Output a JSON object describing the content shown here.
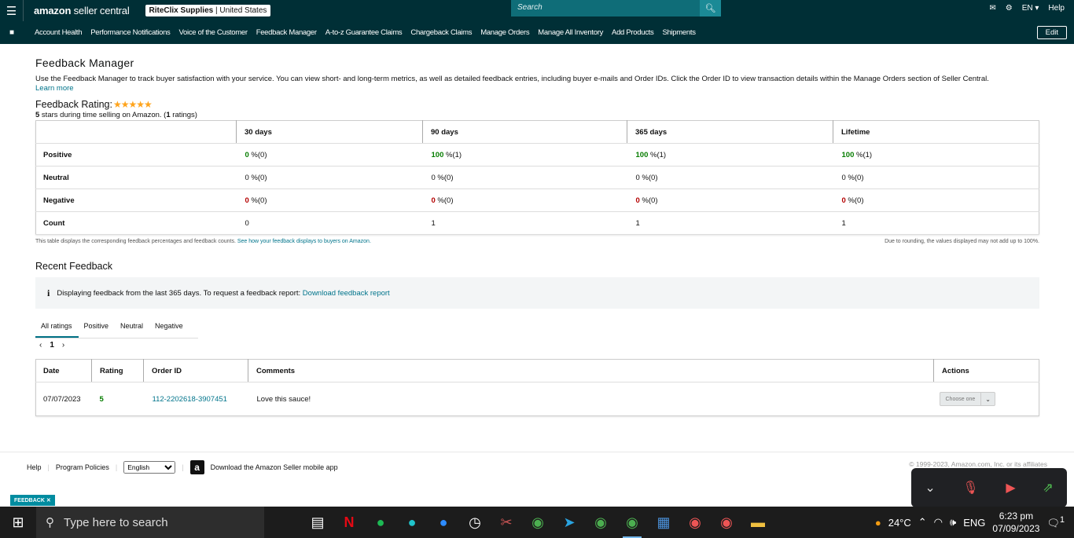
{
  "topbar": {
    "menu_icon": "hamburger-icon",
    "logo_bold": "amazon",
    "logo_rest": " seller central",
    "store_name": "RiteClix Supplies",
    "store_region": "United States",
    "search_placeholder": "Search",
    "language": "EN",
    "help": "Help"
  },
  "nav": {
    "items": [
      "Account Health",
      "Performance Notifications",
      "Voice of the Customer",
      "Feedback Manager",
      "A-to-z Guarantee Claims",
      "Chargeback Claims",
      "Manage Orders",
      "Manage All Inventory",
      "Add Products",
      "Shipments"
    ],
    "edit": "Edit"
  },
  "page": {
    "title": "Feedback Manager",
    "description": "Use the Feedback Manager to track buyer satisfaction with your service. You can view short- and long-term metrics, as well as detailed feedback entries, including buyer e-mails and Order IDs. Click the Order ID to view transaction details within the Manage Orders section of Seller Central.",
    "learn_more": "Learn more",
    "rating_label": "Feedback Rating:",
    "stars": "★★★★★",
    "rating_stars_pre": "5",
    "rating_sub_mid": " stars during time selling on Amazon. (",
    "rating_count": "1",
    "rating_sub_post": " ratings)"
  },
  "summary": {
    "headers": [
      "",
      "30 days",
      "90 days",
      "365 days",
      "Lifetime"
    ],
    "rows": [
      {
        "label": "Positive",
        "cells": [
          {
            "v": "0",
            "s": " %(0)"
          },
          {
            "v": "100",
            "s": " %(1)"
          },
          {
            "v": "100",
            "s": " %(1)"
          },
          {
            "v": "100",
            "s": " %(1)"
          }
        ]
      },
      {
        "label": "Neutral",
        "cells": [
          {
            "v": "0 %(0)"
          },
          {
            "v": "0 %(0)"
          },
          {
            "v": "0 %(0)"
          },
          {
            "v": "0 %(0)"
          }
        ]
      },
      {
        "label": "Negative",
        "cells": [
          {
            "v": "0",
            "s": " %(0)"
          },
          {
            "v": "0",
            "s": " %(0)"
          },
          {
            "v": "0",
            "s": " %(0)"
          },
          {
            "v": "0",
            "s": " %(0)"
          }
        ]
      },
      {
        "label": "Count",
        "cells": [
          {
            "v": "0"
          },
          {
            "v": "1"
          },
          {
            "v": "1"
          },
          {
            "v": "1"
          }
        ]
      }
    ],
    "note_left": "This table displays the corresponding feedback percentages and feedback counts.",
    "note_link": "See how your feedback displays to buyers on Amazon.",
    "note_right": "Due to rounding, the values displayed may not add up to 100%."
  },
  "recent": {
    "title": "Recent Feedback",
    "info_text": "Displaying feedback from the last 365 days. To request a feedback report:",
    "info_link": "Download feedback report",
    "tabs": [
      "All ratings",
      "Positive",
      "Neutral",
      "Negative"
    ],
    "pager_prev": "‹",
    "pager_page": "1",
    "pager_next": "›",
    "headers": [
      "Date",
      "Rating",
      "Order ID",
      "Comments",
      "Actions"
    ],
    "rows": [
      {
        "date": "07/07/2023",
        "rating": "5",
        "order_id": "112-2202618-3907451",
        "comment": "Love this sauce!",
        "action": "Choose one"
      }
    ]
  },
  "footer": {
    "help": "Help",
    "policies": "Program Policies",
    "language": "English",
    "app_text": "Download the Amazon Seller mobile app",
    "copyright": "© 1999-2023, Amazon.com, Inc. or its affiliates",
    "feedback_tab": "FEEDBACK"
  },
  "taskbar": {
    "search_placeholder": "Type here to search",
    "temperature": "24°C",
    "lang": "ENG",
    "time": "6:23 pm",
    "date": "07/09/2023",
    "notifications": "1"
  },
  "colors": {
    "header": "#002f36",
    "link": "#00748b",
    "positive": "#067d00",
    "negative": "#b40000",
    "star": "#ffa41c"
  }
}
